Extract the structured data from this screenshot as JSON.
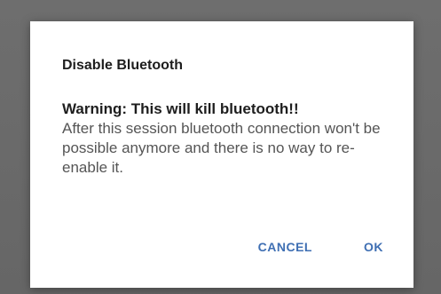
{
  "dialog": {
    "title": "Disable Bluetooth",
    "warning": "Warning: This will kill bluetooth!!",
    "message": "After this session bluetooth connection won't be possible anymore and there is no way to re-enable it.",
    "cancel_label": "CANCEL",
    "ok_label": "OK"
  },
  "colors": {
    "accent": "#3f6fb3",
    "scrim": "#6b6b6b",
    "surface": "#ffffff"
  }
}
